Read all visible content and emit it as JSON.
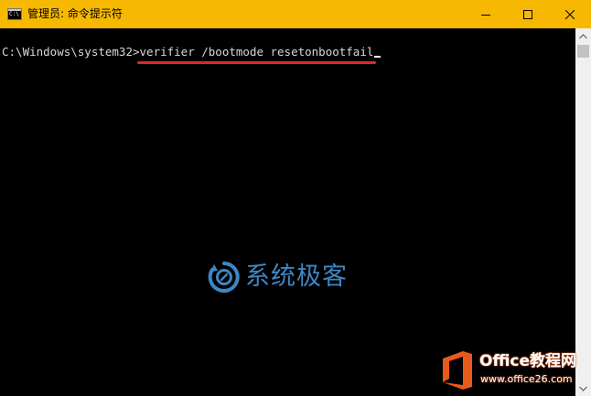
{
  "window": {
    "title": "管理员: 命令提示符",
    "icon": "cmd-icon",
    "icon_prompt": "C:\\",
    "titlebar_color": "#F6B800"
  },
  "caption_buttons": {
    "minimize": "minimize-icon",
    "maximize": "maximize-icon",
    "close": "close-icon"
  },
  "console": {
    "prompt": "C:\\Windows\\system32>",
    "command": "verifier /bootmode resetonbootfail",
    "text_color": "#D8D8D8",
    "background": "#000000",
    "highlight_color": "#E0262D"
  },
  "watermark": {
    "logo": "xitongke-logo-icon",
    "text": "系统极客",
    "color": "#3E86C4"
  },
  "badge": {
    "title": "Office教程网",
    "url": "www.office26.com",
    "icon": "office-logo-icon",
    "accent": "#E85A1A"
  }
}
